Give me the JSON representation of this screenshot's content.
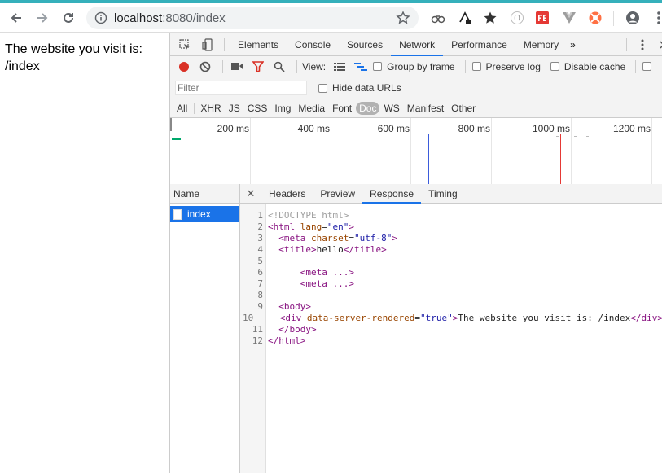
{
  "browser": {
    "url_host": "localhost",
    "url_port_path": ":8080/index",
    "icons": [
      "back-arrow-icon",
      "forward-arrow-icon",
      "reload-icon",
      "info-icon",
      "star-icon",
      "extensions-icon",
      "profile-icon",
      "menu-icon"
    ]
  },
  "page": {
    "text": "The website you visit is: /index"
  },
  "devtools": {
    "tabs": [
      "Elements",
      "Console",
      "Sources",
      "Network",
      "Performance",
      "Memory"
    ],
    "more_tabs": "»",
    "active_tab": "Network",
    "toolbar": {
      "view_label": "View:",
      "group_by_frame": "Group by frame",
      "preserve_log": "Preserve log",
      "disable_cache": "Disable cache"
    },
    "filter": {
      "placeholder": "Filter",
      "hide_data_urls": "Hide data URLs"
    },
    "types": [
      "All",
      "XHR",
      "JS",
      "CSS",
      "Img",
      "Media",
      "Font",
      "Doc",
      "WS",
      "Manifest",
      "Other"
    ],
    "active_type": "Doc",
    "overview_ticks": [
      "200 ms",
      "400 ms",
      "600 ms",
      "800 ms",
      "1000 ms",
      "1200 ms"
    ],
    "names_header": "Name",
    "requests": [
      {
        "name": "index"
      }
    ],
    "detail_tabs": [
      "Headers",
      "Preview",
      "Response",
      "Timing"
    ],
    "active_detail_tab": "Response",
    "response_lines": [
      {
        "n": "1"
      },
      {
        "n": "2"
      },
      {
        "n": "3"
      },
      {
        "n": "4"
      },
      {
        "n": "5"
      },
      {
        "n": "6"
      },
      {
        "n": "7"
      },
      {
        "n": "8"
      },
      {
        "n": "9"
      },
      {
        "n": "10"
      },
      {
        "n": "11"
      },
      {
        "n": "12"
      }
    ],
    "code": {
      "l1": "<!DOCTYPE html>",
      "l2_tag": "<html ",
      "l2_attr": "lang",
      "l2_val": "\"en\"",
      "l3_attr": "charset",
      "l3_val": "\"utf-8\"",
      "l4_text": "hello",
      "l6": "<meta ...>",
      "l7": "<meta ...>",
      "l9": "<body>",
      "l10_attr": "data-server-rendered",
      "l10_val": "\"true\"",
      "l10_text": "The website you visit is: /index",
      "l11": "</body>",
      "l12": "</html>"
    },
    "colors": {
      "accent": "#1a73e8",
      "selected_type_bg": "#b2b2b2",
      "record": "#d93025"
    }
  }
}
